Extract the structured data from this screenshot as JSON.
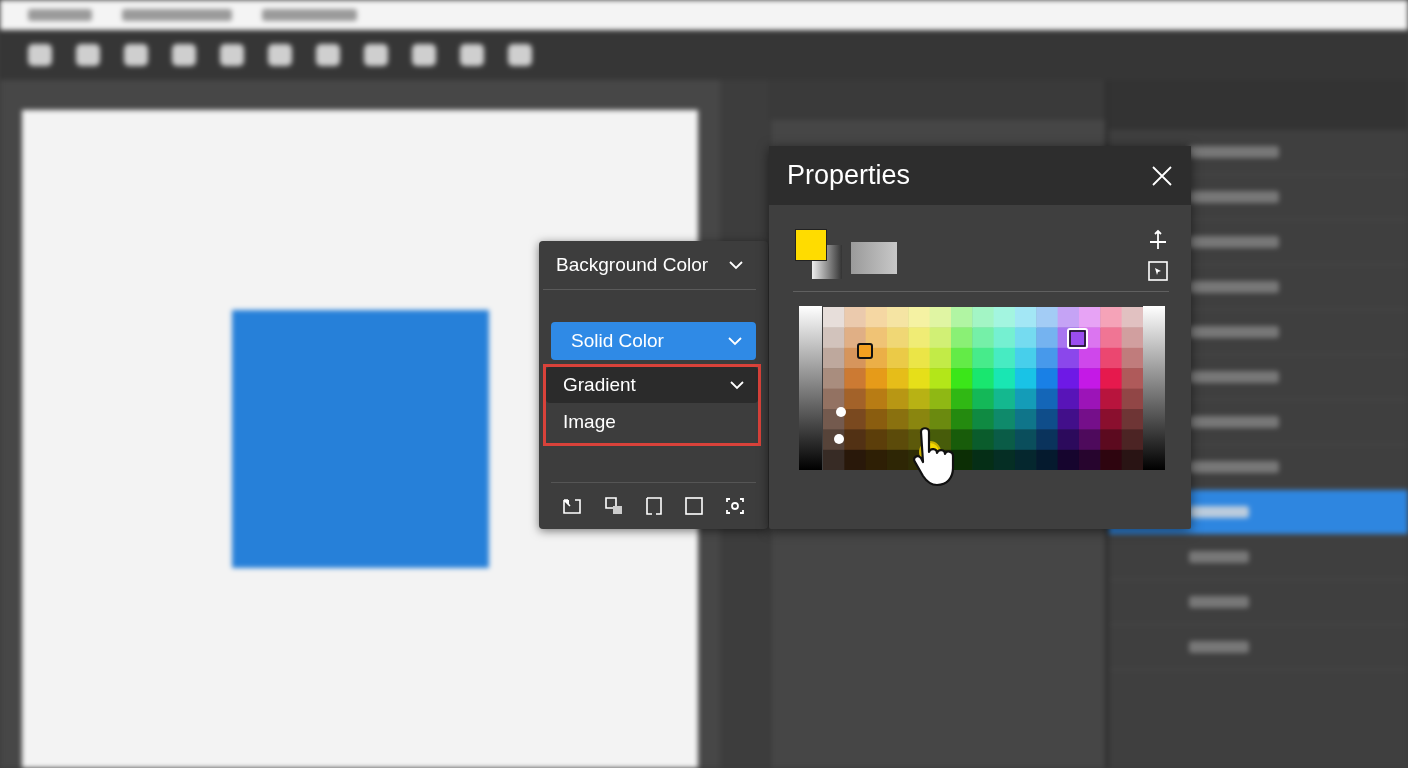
{
  "background_menu": {
    "title": "Background Color",
    "options": [
      {
        "label": "Solid Color",
        "kind": "select",
        "selected": true,
        "outlined": false
      },
      {
        "label": "Gradient",
        "kind": "select",
        "selected": false,
        "outlined": true
      },
      {
        "label": "Image",
        "kind": "option",
        "selected": false,
        "outlined": true
      }
    ]
  },
  "properties_panel": {
    "title": "Properties"
  }
}
